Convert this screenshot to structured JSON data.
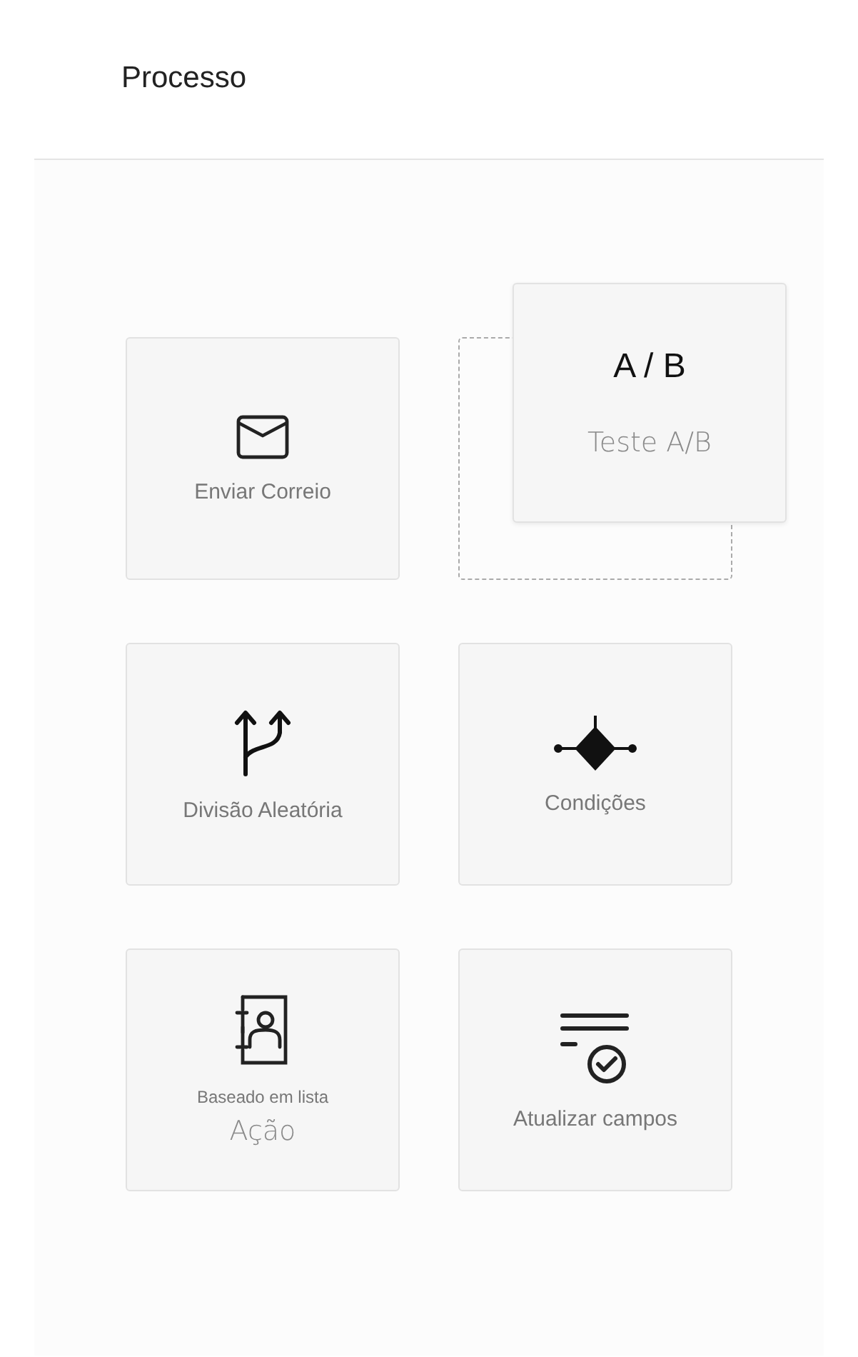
{
  "title": "Processo",
  "tiles": [
    {
      "kind": "mail",
      "label": "Enviar Correio",
      "dragging": false
    },
    {
      "kind": "ab",
      "glyph": "A / B",
      "label": "Teste A/B",
      "dragging": true
    },
    {
      "kind": "split",
      "label": "Divisão Aleatória",
      "dragging": false
    },
    {
      "kind": "condition",
      "label": "Condições",
      "dragging": false
    },
    {
      "kind": "contact",
      "sublabel": "Baseado em lista",
      "label": "Ação",
      "dragging": false
    },
    {
      "kind": "update",
      "label": "Atualizar campos",
      "dragging": false
    }
  ]
}
